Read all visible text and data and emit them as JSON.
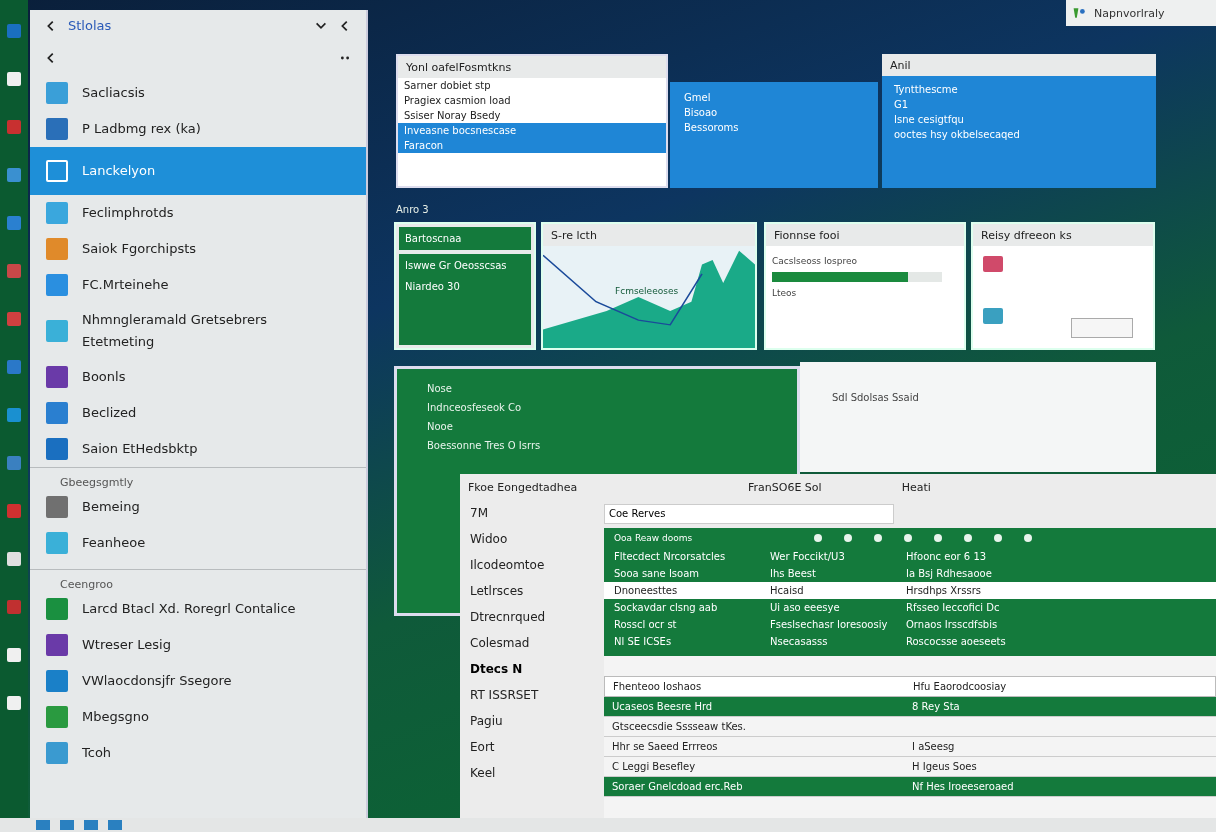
{
  "notification": {
    "text": "Napnvorlraly"
  },
  "start_menu": {
    "title": "Stlolas",
    "items": [
      {
        "label": "Sacliacsis",
        "selected": false
      },
      {
        "label": "P Ladbmg rex (ka)",
        "selected": false
      },
      {
        "label": "Lanckelyon",
        "selected": true
      },
      {
        "label": "Feclimphrotds",
        "selected": false
      },
      {
        "label": "Saiok Fgorchipsts",
        "selected": false
      },
      {
        "label": "FC.Mrteinehe",
        "selected": false
      },
      {
        "label": "Nhmngleramald Gretsebrers Etetmeting",
        "selected": false
      },
      {
        "label": "Boonls",
        "selected": false
      },
      {
        "label": "Beclized",
        "selected": false
      },
      {
        "label": "Saion EtHedsbktp",
        "selected": false
      }
    ],
    "groups": [
      {
        "heading": "Gbeegsgmtly",
        "items": [
          "Bemeing",
          "Feanheoe"
        ]
      },
      {
        "heading": "Ceengroo",
        "items": [
          "Larcd Btacl Xd. Roregrl Contalice",
          "Wtreser Lesig",
          "VWlaocdonsjfr Ssegore",
          "Mbegsgno",
          "Tcoh"
        ]
      }
    ]
  },
  "top_windows": [
    {
      "title": "Yonl oafelFosmtkns",
      "rows": [
        {
          "text": "Sarner dobiet stp",
          "selected": false
        },
        {
          "text": "Pragiex casmion load",
          "selected": false
        },
        {
          "text": "Ssiser Noray Bsedy",
          "selected": false
        },
        {
          "text": "Inveasne bocsnescase",
          "selected": true
        },
        {
          "text": "Faracon",
          "selected": true
        }
      ]
    },
    {
      "rows": [
        {
          "text": "Gmel",
          "selected": true
        },
        {
          "text": "Bisoao",
          "selected": true
        },
        {
          "text": "Bessoroms",
          "selected": true
        }
      ]
    },
    {
      "title": "Anil",
      "rows": [
        {
          "text": "Tyntthescme",
          "selected": true
        },
        {
          "text": "G1",
          "selected": true
        },
        {
          "text": "Isne cesigtfqu",
          "selected": true
        },
        {
          "text": "ooctes hsy okbelsecaqed",
          "selected": true
        }
      ]
    }
  ],
  "group_label": "Anro 3",
  "mid_windows": [
    {
      "kind": "green",
      "title": "Bartoscnaa",
      "lines": [
        "Iswwe Gr Oeosscsas",
        "Niardeo 30"
      ]
    },
    {
      "kind": "chart",
      "title": "S-re lcth",
      "lines": [
        "Fcmseleeoses"
      ]
    },
    {
      "kind": "form",
      "title": "Fionnse fooi",
      "lines": [
        "Cacslseoss Iospreo",
        "Lteos"
      ],
      "level": 0.8
    },
    {
      "kind": "gallery",
      "title": "Reisy dfreeon ks"
    }
  ],
  "back_window": {
    "lines": [
      "Nose",
      "Indnceosfeseok Co",
      "Nooe",
      "Boessonne Tres O Isrrs"
    ],
    "side_title": "Sdl Sdolsas Ssaid"
  },
  "front_window": {
    "title": "Fkoe Eongedtadhea",
    "app": "FranSO6E Sol",
    "right": "Heati",
    "nav": [
      {
        "label": "7M",
        "selected": false
      },
      {
        "label": "Widoo",
        "selected": false
      },
      {
        "label": "Ilcodeomtoe",
        "selected": false
      },
      {
        "label": "Letlrsces",
        "selected": false
      },
      {
        "label": "Dtrecnrqued",
        "selected": false
      },
      {
        "label": "Colesmad",
        "selected": false
      },
      {
        "label": "Dtecs N",
        "selected": true
      },
      {
        "label": "RT ISSRSET",
        "selected": false
      },
      {
        "label": "Pagiu",
        "selected": false
      },
      {
        "label": "Eort",
        "selected": false
      },
      {
        "label": "Keel",
        "selected": false
      }
    ],
    "search": {
      "value": "Coe Rerves"
    },
    "toolbar_label": "Ooa Reaw dooms",
    "rows": [
      {
        "cells": [
          "Fltecdect Nrcorsatcles",
          "Wer Foccikt/U3",
          "Hfoonc eor 6 13"
        ],
        "selected": false
      },
      {
        "cells": [
          "Sooa sane Isoam",
          "Ihs Beest",
          "Ia Bsj Rdhesaooe"
        ],
        "selected": false
      },
      {
        "cells": [
          "Dnoneesttes",
          "Hcaisd",
          "Hrsdhps Xrssrs"
        ],
        "selected": true
      },
      {
        "cells": [
          "Sockavdar clsng aab",
          "Ui aso eeesye",
          "Rfsseo Ieccofici Dc"
        ],
        "selected": false
      },
      {
        "cells": [
          "Rosscl ocr st",
          "Fseslsechasr Ioresoosiy",
          "Ornaos Irsscdfsbis"
        ],
        "selected": false
      },
      {
        "cells": [
          "Nl SE ICSEs",
          "Nsecasasss",
          "Roscocsse aoeseets"
        ],
        "selected": false
      }
    ],
    "lower_headers": [
      "Fhenteoo Ioshaos",
      "Hfu Eaorodcoosiay"
    ],
    "lower_rows": [
      {
        "cells": [
          "Ucaseos Beesre Hrd",
          "8 Rey Sta"
        ],
        "selected": true
      },
      {
        "cells": [
          "Gtsceecsdie Sssseaw tKes."
        ],
        "selected": false
      },
      {
        "cells": [
          "Hhr se Saeed Errreos",
          "I aSeesg"
        ],
        "selected": false
      },
      {
        "cells": [
          "C Leggi Besefley",
          "H Igeus Soes"
        ],
        "selected": false
      },
      {
        "cells": [
          "Soraer Gnelcdoad erc.Reb",
          "Nf Hes Iroeeseroaed"
        ],
        "selected": true
      }
    ]
  }
}
